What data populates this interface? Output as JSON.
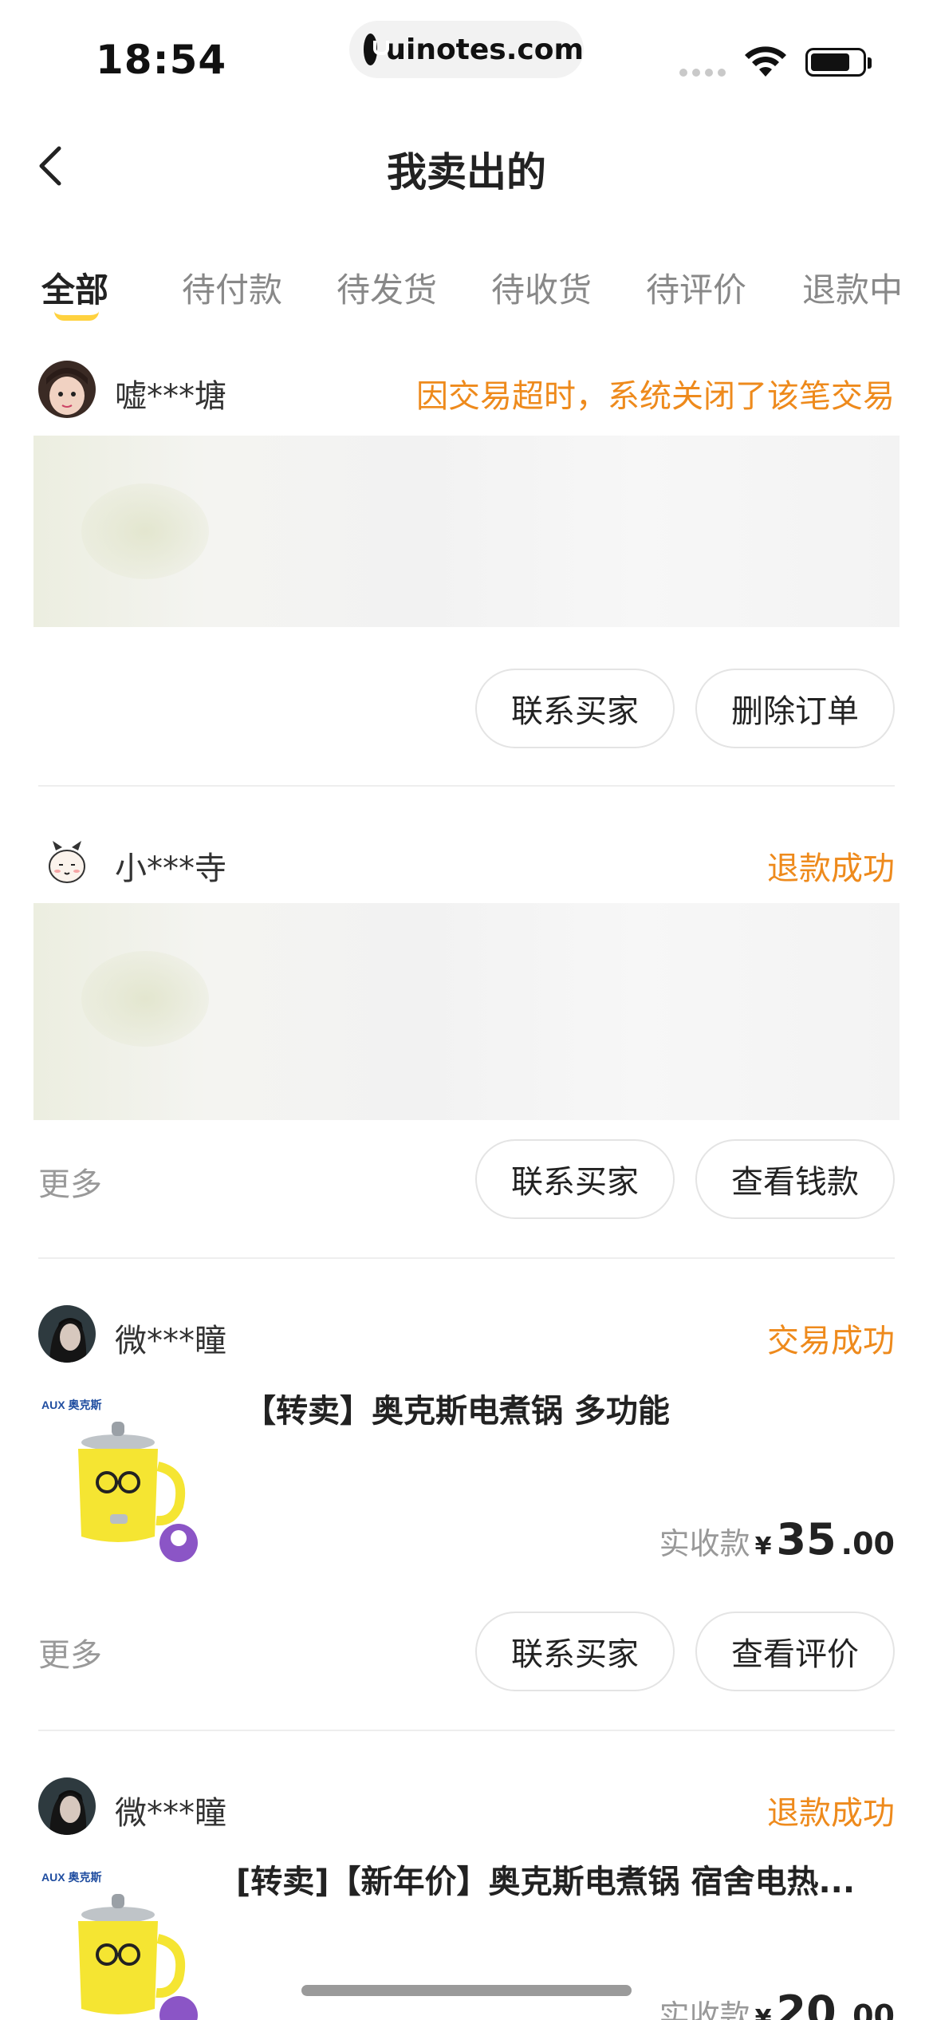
{
  "status_bar": {
    "time": "18:54",
    "url": "uinotes.com"
  },
  "nav": {
    "title": "我卖出的"
  },
  "tabs": [
    {
      "label": "全部",
      "active": true
    },
    {
      "label": "待付款"
    },
    {
      "label": "待发货"
    },
    {
      "label": "待收货"
    },
    {
      "label": "待评价"
    },
    {
      "label": "退款中"
    }
  ],
  "orders": [
    {
      "buyer": "嘘***塘",
      "status": "因交易超时，系统关闭了该笔交易",
      "buttons": [
        "联系买家",
        "删除订单"
      ]
    },
    {
      "buyer": "小***寺",
      "status": "退款成功",
      "more": "更多",
      "buttons": [
        "联系买家",
        "查看钱款"
      ]
    },
    {
      "buyer": "微***瞳",
      "status": "交易成功",
      "product_title": "【转卖】奥克斯电煮锅 多功能",
      "price_label": "实收款",
      "currency": "¥",
      "price_int": "35",
      "price_dec": ".00",
      "more": "更多",
      "buttons": [
        "联系买家",
        "查看评价"
      ],
      "brand": "AUX 奥克斯"
    },
    {
      "buyer": "微***瞳",
      "status": "退款成功",
      "product_title": "[转卖]【新年价】奥克斯电煮锅 宿舍电热...",
      "price_label": "实收款",
      "currency": "¥",
      "price_int": "20",
      "price_dec": ".00",
      "brand": "AUX 奥克斯"
    }
  ],
  "colors": {
    "status": "#ee8a1c",
    "tab_underline": "#ffd23f"
  }
}
